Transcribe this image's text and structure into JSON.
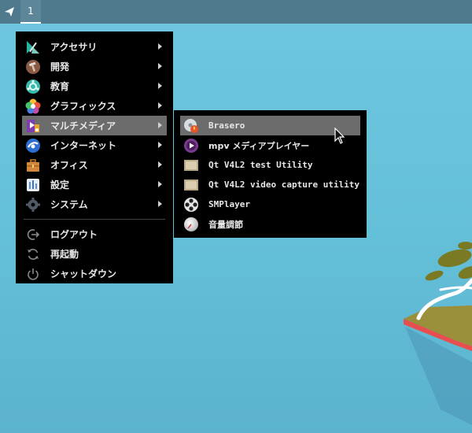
{
  "panel": {
    "workspace_label": "1"
  },
  "main_menu": {
    "items": [
      {
        "label": "アクセサリ",
        "icon": "accessories-icon",
        "submenu": true
      },
      {
        "label": "開発",
        "icon": "development-icon",
        "submenu": true
      },
      {
        "label": "教育",
        "icon": "education-icon",
        "submenu": true
      },
      {
        "label": "グラフィックス",
        "icon": "graphics-icon",
        "submenu": true
      },
      {
        "label": "マルチメディア",
        "icon": "multimedia-icon",
        "submenu": true,
        "active": true
      },
      {
        "label": "インターネット",
        "icon": "internet-icon",
        "submenu": true
      },
      {
        "label": "オフィス",
        "icon": "office-icon",
        "submenu": true
      },
      {
        "label": "設定",
        "icon": "settings-icon",
        "submenu": true
      },
      {
        "label": "システム",
        "icon": "system-icon",
        "submenu": true
      }
    ],
    "actions": [
      {
        "label": "ログアウト",
        "icon": "logout-icon"
      },
      {
        "label": "再起動",
        "icon": "reboot-icon"
      },
      {
        "label": "シャットダウン",
        "icon": "shutdown-icon"
      }
    ]
  },
  "sub_menu": {
    "items": [
      {
        "label": "Brasero",
        "icon": "brasero-icon",
        "active": true
      },
      {
        "label": "mpv メディアプレイヤー",
        "icon": "mpv-icon"
      },
      {
        "label": "Qt V4L2 test Utility",
        "icon": "qv4l2-icon"
      },
      {
        "label": "Qt V4L2 video capture utility",
        "icon": "qvidcap-icon"
      },
      {
        "label": "SMPlayer",
        "icon": "smplayer-icon"
      },
      {
        "label": "音量調節",
        "icon": "volume-control-icon"
      }
    ]
  },
  "colors": {
    "desktop": "#66c1da",
    "panel": "#4f7a8d",
    "menu_bg": "#000000",
    "highlight": "#6c6c6c"
  }
}
